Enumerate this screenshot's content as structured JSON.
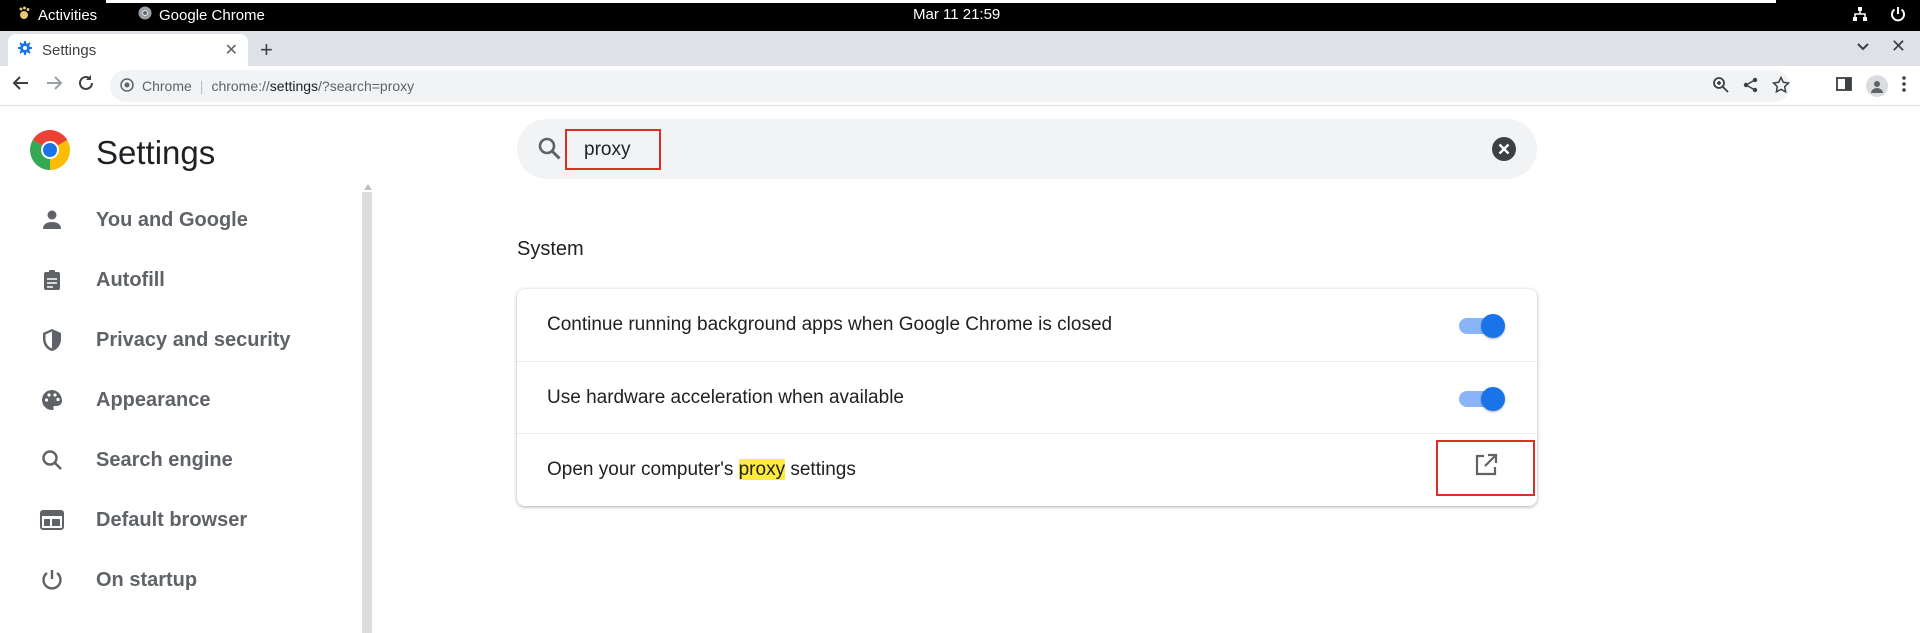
{
  "topbar": {
    "activities": "Activities",
    "app_name": "Google Chrome",
    "clock": "Mar 11  21:59"
  },
  "tabs": [
    {
      "label": "Settings"
    }
  ],
  "omnibox": {
    "site_label": "Chrome",
    "url_prefix": "chrome://",
    "url_bold": "settings",
    "url_suffix": "/?search=proxy"
  },
  "settings": {
    "brand": "Settings",
    "nav": [
      {
        "label": "You and Google",
        "icon": "person-icon"
      },
      {
        "label": "Autofill",
        "icon": "clipboard-icon"
      },
      {
        "label": "Privacy and security",
        "icon": "shield-icon"
      },
      {
        "label": "Appearance",
        "icon": "palette-icon"
      },
      {
        "label": "Search engine",
        "icon": "search-icon"
      },
      {
        "label": "Default browser",
        "icon": "browser-window-icon"
      },
      {
        "label": "On startup",
        "icon": "power-icon"
      }
    ],
    "search": {
      "query": "proxy"
    },
    "section": "System",
    "rows": [
      {
        "label": "Continue running background apps when Google Chrome is closed",
        "control": "toggle",
        "on": true
      },
      {
        "label": "Use hardware acceleration when available",
        "control": "toggle",
        "on": true
      },
      {
        "label_before": "Open your computer's ",
        "label_highlight": "proxy",
        "label_after": " settings",
        "control": "external-link"
      }
    ]
  },
  "colors": {
    "accent": "#1a73e8",
    "highlight": "#ffeb3b",
    "annotation_box": "#d93025"
  }
}
